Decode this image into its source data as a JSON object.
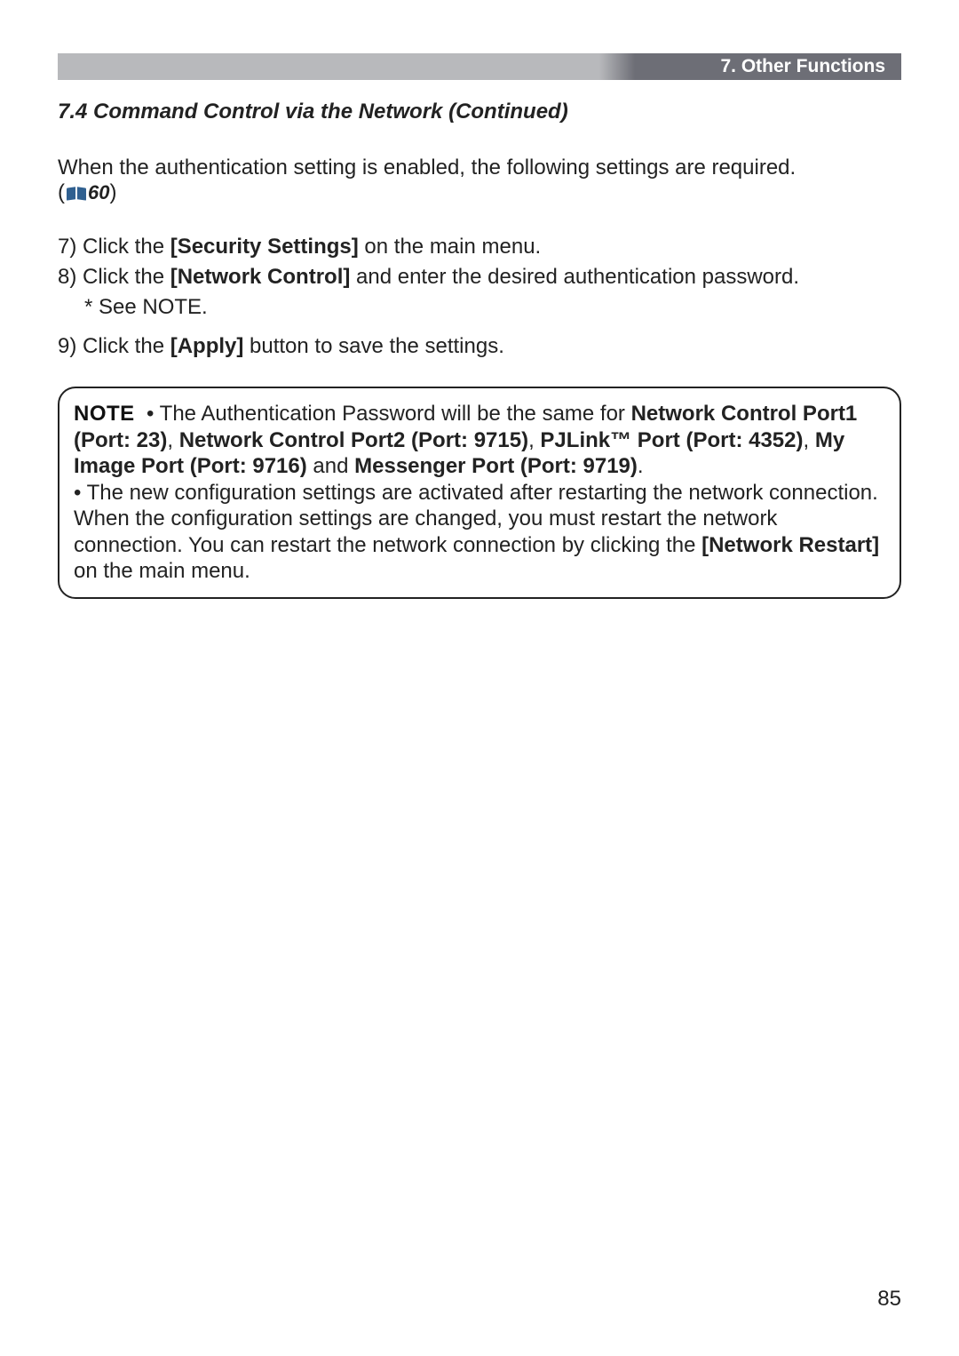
{
  "header": {
    "chapter": "7. Other Functions"
  },
  "section_title": "7.4 Command Control via the Network (Continued)",
  "intro_text": "When the authentication setting is enabled, the following settings are required.",
  "ref_num": "60",
  "steps": {
    "s7_prefix": "7) Click the ",
    "s7_bold": "[Security Settings]",
    "s7_rest": " on the main menu.",
    "s8_prefix": "8) Click the ",
    "s8_bold": "[Network Control]",
    "s8_rest": " and enter the desired authentication password.",
    "s8_note": "* See NOTE.",
    "s9_prefix": "9) Click the ",
    "s9_bold": "[Apply]",
    "s9_rest": " button to save the settings."
  },
  "note": {
    "label": "NOTE",
    "l1a": "• The Authentication Password will be the same for ",
    "l1b": "Network Control Port1 (Port: 23)",
    "l1c": ", ",
    "l1d": "Network Control Port2 (Port: 9715)",
    "l1e": ", ",
    "l1f": "PJLink™ Port (Port: 4352)",
    "l1g": ", ",
    "l1h": "My Image Port (Port: 9716)",
    "l1i": " and ",
    "l1j": "Messenger Port (Port: 9719)",
    "l1k": ".",
    "l2": "• The new configuration settings are activated after restarting the network connection. When the configuration settings are changed, you must restart the network connection. You can restart the network connection by clicking the ",
    "l2b": "[Network Restart]",
    "l2c": " on the main menu."
  },
  "page_number": "85"
}
